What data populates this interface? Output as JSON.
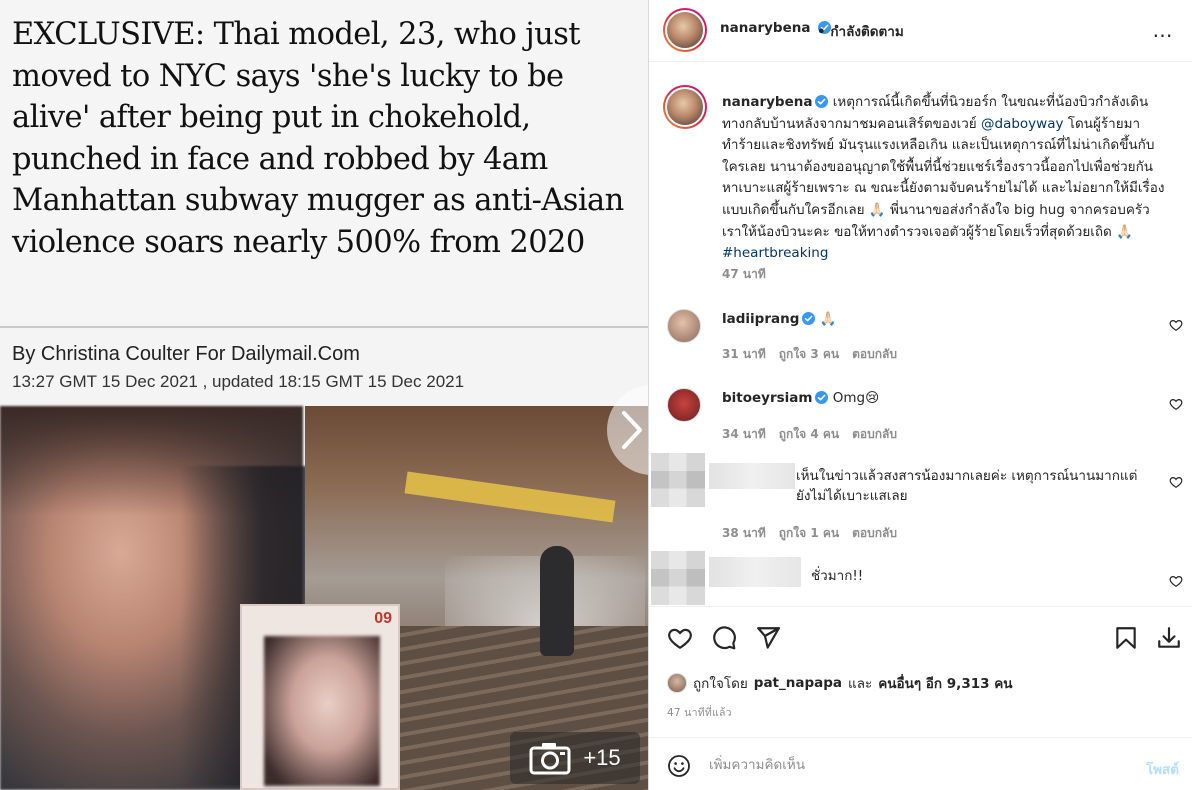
{
  "media": {
    "headline": "EXCLUSIVE: Thai model, 23, who just moved to NYC says 'she's lucky to be alive' after being put in chokehold, punched in face and robbed by 4am Manhattan subway mugger as anti-Asian violence soars nearly 500% from 2020",
    "byline": "By Christina Coulter For Dailymail.Com",
    "dateline": "13:27 GMT 15 Dec 2021 , updated 18:15 GMT 15 Dec 2021",
    "inset_number": "09",
    "gallery_count": "+15"
  },
  "header": {
    "username": "nanarybena",
    "separator": "•",
    "follow_status": "กำลังติดตาม",
    "more_icon": "…"
  },
  "caption": {
    "username": "nanarybena",
    "text_before_mention": "เหตุการณ์นี้เกิดขึ้นที่นิวยอร์ก ในขณะที่น้องบิวกำลังเดินทางกลับบ้านหลังจากมาชมคอนเสิร์ตของเวย์ ",
    "mention": "@daboyway",
    "text_after_mention": " โดนผู้ร้ายมาทำร้ายและชิงทรัพย์ มันรุนแรงเหลือเกิน และเป็นเหตุการณ์ที่ไม่น่าเกิดขึ้นกับใครเลย นานาต้องขออนุญาตใช้พื้นที่นี้ช่วยแชร์เรื่องราวนี้ออกไปเพื่อช่วยกันหาเบาะแสผู้ร้ายเพราะ ณ ขณะนี้ยังตามจับคนร้ายไม่ได้ และไม่อยากให้มีเรื่องแบบเกิดขึ้นกับใครอีกเลย 🙏🏻 พี่นานาขอส่งกำลังใจ big hug จากครอบครัวเราให้น้องบิวนะคะ ขอให้ทางตำรวจเจอตัวผู้ร้ายโดยเร็วที่สุดด้วยเถิด 🙏🏻 ",
    "hashtag": "#heartbreaking",
    "time": "47 นาที"
  },
  "comments": [
    {
      "username": "ladiiprang",
      "text": "🙏🏻",
      "time": "31 นาที",
      "likes": "ถูกใจ 3 คน",
      "reply": "ตอบกลับ"
    },
    {
      "username": "bitoeyrsiam",
      "text": "Omg😢",
      "time": "34 นาที",
      "likes": "ถูกใจ 4 คน",
      "reply": "ตอบกลับ"
    },
    {
      "username": "",
      "text": "เห็นในข่าวแล้วสงสารน้องมากเลยค่ะ เหตุการณ์นานมากแต่ยังไม่ได้เบาะแสเลย",
      "time": "38 นาที",
      "likes": "ถูกใจ 1 คน",
      "reply": "ตอบกลับ"
    },
    {
      "username": "",
      "text": "ชั่วมาก!!"
    }
  ],
  "likes": {
    "prefix": "ถูกใจโดย",
    "liker": "pat_napapa",
    "connector": "และ",
    "others": "คนอื่นๆ อีก 9,313 คน"
  },
  "timestamp": "47 นาทีที่แล้ว",
  "add_comment": {
    "placeholder": "เพิ่มความคิดเห็น",
    "post_label": "โพสต์"
  },
  "icons": {
    "verified_color": "#3897f0",
    "heart": "heart-icon",
    "comment": "comment-icon",
    "share": "send-icon",
    "save": "bookmark-icon",
    "download": "download-icon",
    "emoji": "emoji-icon",
    "camera": "camera-icon",
    "next": "chevron-right-icon"
  }
}
